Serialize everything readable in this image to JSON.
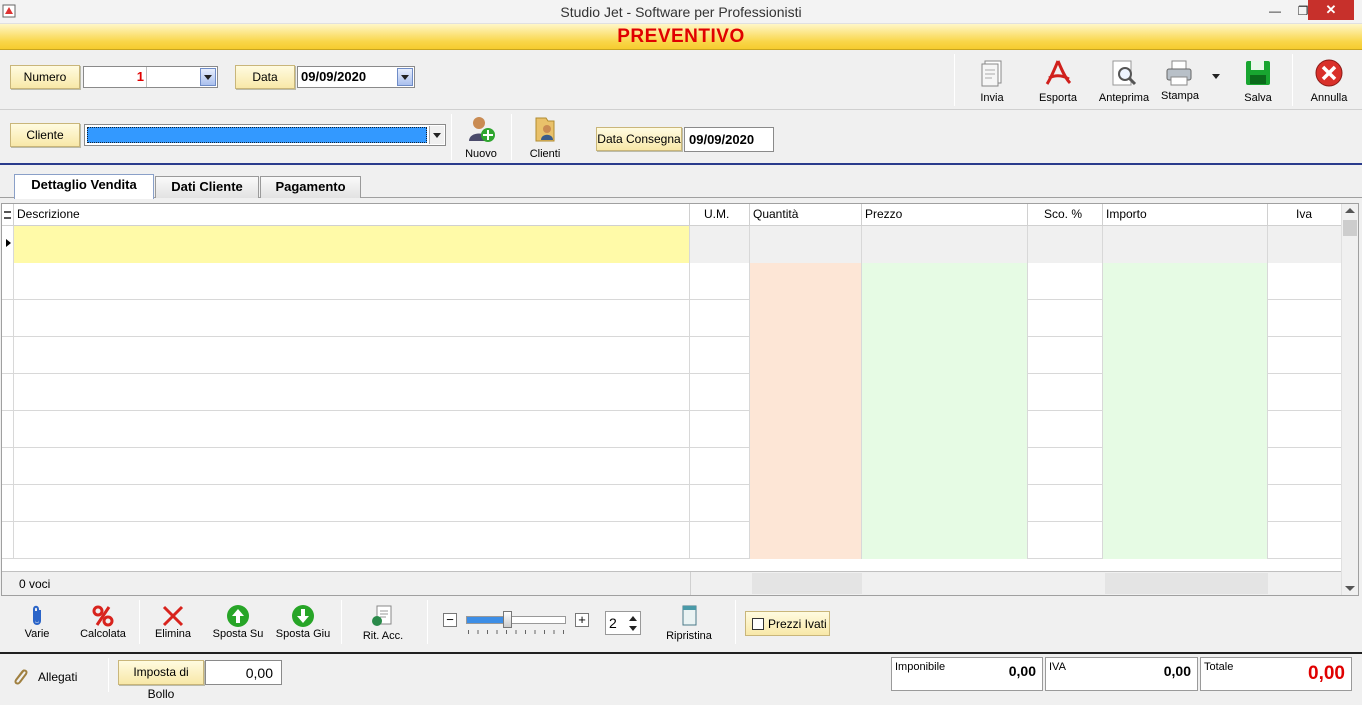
{
  "window": {
    "title": "Studio Jet - Software per Professionisti",
    "minimize": "—",
    "restore": "❐",
    "close": "✕"
  },
  "header": {
    "title": "PREVENTIVO"
  },
  "form": {
    "numero_label": "Numero",
    "numero_value": "1",
    "data_label": "Data",
    "data_value": "09/09/2020",
    "cliente_label": "Cliente",
    "cliente_value": "",
    "data_consegna_label": "Data Consegna",
    "data_consegna_value": "09/09/2020"
  },
  "toolbar": {
    "nuovo": "Nuovo",
    "clienti": "Clienti",
    "invia": "Invia",
    "esporta": "Esporta",
    "anteprima": "Anteprima",
    "stampa": "Stampa",
    "salva": "Salva",
    "annulla": "Annulla"
  },
  "tabs": [
    "Dettaglio Vendita",
    "Dati Cliente",
    "Pagamento"
  ],
  "grid": {
    "columns": [
      "Descrizione",
      "U.M.",
      "Quantità",
      "Prezzo",
      "Sco. %",
      "Importo",
      "Iva"
    ],
    "footer_count": "0 voci"
  },
  "bottom_tools": {
    "varie": "Varie",
    "calcolata": "Calcolata",
    "elimina": "Elimina",
    "sposta_su": "Sposta Su",
    "sposta_giu": "Sposta Giu",
    "rit_acc": "Rit. Acc.",
    "decimals": "2",
    "ripristina": "Ripristina",
    "prezzi_ivati": "Prezzi Ivati"
  },
  "status": {
    "allegati": "Allegati",
    "imposta_bollo_label": "Imposta di Bollo",
    "imposta_bollo_value": "0,00",
    "imponibile_label": "Imponibile",
    "imponibile_value": "0,00",
    "iva_label": "IVA",
    "iva_value": "0,00",
    "totale_label": "Totale",
    "totale_value": "0,00"
  },
  "colors": {
    "accent_red": "#e00000",
    "header_yellow": "#f9d64a",
    "qty_column": "#fde6d6",
    "price_column": "#e6fbe4",
    "selected_row": "#fffaa8"
  }
}
